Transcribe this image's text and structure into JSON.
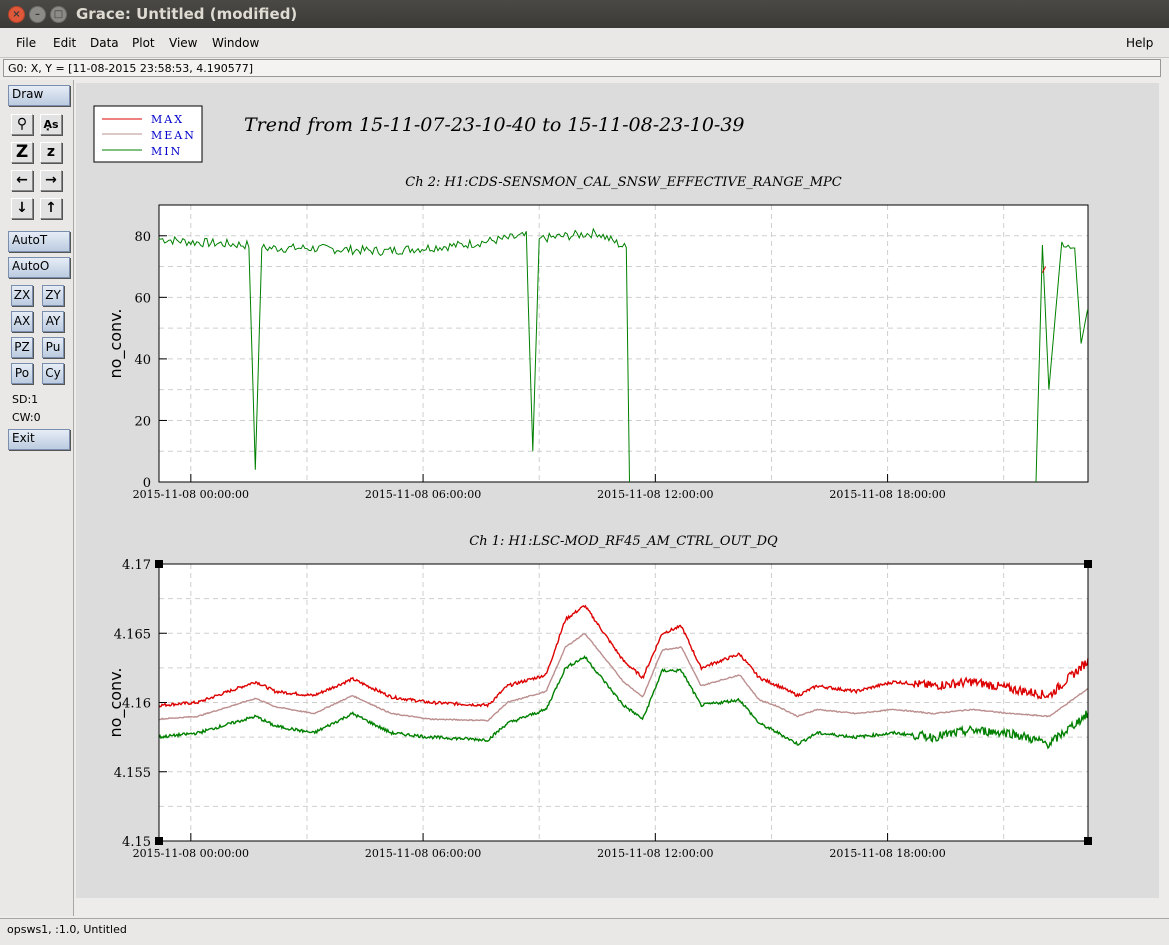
{
  "window": {
    "title": "Grace: Untitled (modified)"
  },
  "menu": {
    "left": [
      {
        "name": "file",
        "label": "File"
      },
      {
        "name": "edit",
        "label": "Edit"
      },
      {
        "name": "data",
        "label": "Data"
      },
      {
        "name": "plot",
        "label": "Plot"
      },
      {
        "name": "view",
        "label": "View"
      },
      {
        "name": "window",
        "label": "Window"
      }
    ],
    "help": "Help"
  },
  "locator": "G0: X, Y = [11-08-2015 23:58:53, 4.190577]",
  "toolbar": {
    "draw": "Draw",
    "autot": "AutoT",
    "autoo": "AutoO",
    "zx": "ZX",
    "zy": "ZY",
    "ax": "AX",
    "ay": "AY",
    "pz": "PZ",
    "pu": "Pu",
    "po": "Po",
    "cy": "Cy",
    "sd": "SD:1",
    "cw": "CW:0",
    "exit": "Exit",
    "icons": [
      "magnifier-icon",
      "text-as-icon",
      "zoom-Z-icon",
      "zoom-z-icon",
      "arrow-left-icon",
      "arrow-right-icon",
      "arrow-down-icon",
      "arrow-up-icon"
    ]
  },
  "status": "opsws1, :1.0, Untitled",
  "colors": {
    "max": "#dd0000",
    "mean": "#bc8f8f",
    "min": "#008000",
    "legend_text": "#0000cc"
  },
  "legend": [
    "MAX",
    "MEAN",
    "MIN"
  ],
  "main_title": "Trend from 15-11-07-23-10-40 to 15-11-08-23-10-39",
  "chart_data": [
    {
      "type": "line",
      "title": "Ch 2: H1:CDS-SENSMON_CAL_SNSW_EFFECTIVE_RANGE_MPC",
      "ylabel": "no_conv.",
      "xlim": [
        "2015-11-07 23:10:40",
        "2015-11-08 23:10:39"
      ],
      "ylim": [
        0,
        90
      ],
      "yticks": [
        "0",
        "20",
        "40",
        "60",
        "80"
      ],
      "xticks": [
        "2015-11-08 00:00:00",
        "2015-11-08 06:00:00",
        "2015-11-08 12:00:00",
        "2015-11-08 18:00:00"
      ],
      "grid": true,
      "series": [
        {
          "name": "MIN",
          "x": [
            "2015-11-07 23:10",
            "2015-11-08 00:00",
            "2015-11-08 01:30",
            "2015-11-08 01:40",
            "2015-11-08 01:50",
            "2015-11-08 03:00",
            "2015-11-08 05:00",
            "2015-11-08 07:00",
            "2015-11-08 08:40",
            "2015-11-08 08:50",
            "2015-11-08 09:00",
            "2015-11-08 10:30",
            "2015-11-08 11:15",
            "2015-11-08 11:20",
            "2015-11-08 11:25",
            "2015-11-08 12:00",
            "2015-11-08 21:50",
            "2015-11-08 22:00",
            "2015-11-08 22:10",
            "2015-11-08 22:30",
            "2015-11-08 22:50",
            "2015-11-08 23:00",
            "2015-11-08 23:10"
          ],
          "values": [
            79,
            78,
            77,
            4,
            76,
            76,
            75,
            77,
            80,
            10,
            79,
            81,
            76,
            0,
            null,
            null,
            0,
            77,
            30,
            78,
            76,
            45,
            56
          ]
        },
        {
          "name": "MAX",
          "x": [
            "2015-11-08 22:00",
            "2015-11-08 22:05"
          ],
          "values": [
            68,
            70
          ]
        }
      ]
    },
    {
      "type": "line",
      "title": "Ch 1: H1:LSC-MOD_RF45_AM_CTRL_OUT_DQ",
      "ylabel": "no_conv.",
      "xlim": [
        "2015-11-07 23:10:40",
        "2015-11-08 23:10:39"
      ],
      "ylim": [
        4.15,
        4.17
      ],
      "yticks": [
        "4.15",
        "4.155",
        "4.16",
        "4.165",
        "4.17"
      ],
      "xticks": [
        "2015-11-08 00:00:00",
        "2015-11-08 06:00:00",
        "2015-11-08 12:00:00",
        "2015-11-08 18:00:00"
      ],
      "grid": true,
      "x_hours": [
        0,
        1,
        2.5,
        3,
        4,
        5,
        6,
        7,
        8.5,
        9,
        10,
        10.5,
        11,
        12,
        12.5,
        13,
        13.5,
        14,
        15,
        15.5,
        16,
        16.5,
        17,
        18,
        19,
        20,
        21,
        22,
        23,
        24
      ],
      "series": [
        {
          "name": "MAX",
          "values": [
            4.1598,
            4.16,
            4.1615,
            4.1608,
            4.1605,
            4.1617,
            4.1604,
            4.16,
            4.1598,
            4.1612,
            4.162,
            4.166,
            4.167,
            4.163,
            4.1618,
            4.165,
            4.1655,
            4.1625,
            4.1635,
            4.1618,
            4.1612,
            4.1605,
            4.1612,
            4.1608,
            4.1615,
            4.1612,
            4.1615,
            4.161,
            4.1605,
            4.163
          ]
        },
        {
          "name": "MEAN",
          "values": [
            4.1588,
            4.159,
            4.1603,
            4.1597,
            4.1592,
            4.1605,
            4.1592,
            4.1588,
            4.1587,
            4.16,
            4.1608,
            4.164,
            4.165,
            4.1615,
            4.1604,
            4.1638,
            4.164,
            4.1612,
            4.162,
            4.1602,
            4.1597,
            4.159,
            4.1595,
            4.1592,
            4.1595,
            4.1592,
            4.1595,
            4.1592,
            4.159,
            4.161
          ]
        },
        {
          "name": "MIN",
          "values": [
            4.1575,
            4.1578,
            4.159,
            4.1583,
            4.1578,
            4.1592,
            4.1578,
            4.1575,
            4.1573,
            4.1585,
            4.1595,
            4.1625,
            4.1633,
            4.1598,
            4.1588,
            4.1623,
            4.1623,
            4.1598,
            4.1602,
            4.1585,
            4.1578,
            4.157,
            4.1578,
            4.1575,
            4.1578,
            4.1575,
            4.158,
            4.1578,
            4.157,
            4.1592
          ]
        }
      ]
    }
  ]
}
